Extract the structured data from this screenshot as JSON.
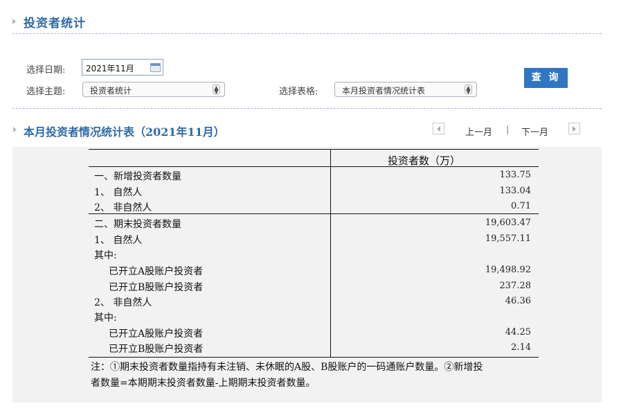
{
  "header": {
    "title": "投资者统计"
  },
  "form": {
    "date_label": "选择日期:",
    "date_value": "2021年11月",
    "topic_label": "选择主题:",
    "topic_value": "投资者统计",
    "table_label": "选择表格:",
    "table_value": "本月投资者情况统计表",
    "query_button": "查 询"
  },
  "section": {
    "title": "本月投资者情况统计表（2021年11月）",
    "prev_label": "上一月",
    "separator": "|",
    "next_label": "下一月"
  },
  "table": {
    "column_header": "投资者数（万）",
    "rows": [
      {
        "label": "一、新增投资者数量",
        "value": "133.75"
      },
      {
        "label": "1、 自然人",
        "value": "133.04"
      },
      {
        "label": "2、 非自然人",
        "value": "0.71"
      },
      {
        "label": "二、期末投资者数量",
        "value": "19,603.47"
      },
      {
        "label": "1、 自然人",
        "value": "19,557.11"
      },
      {
        "label": "其中:",
        "value": ""
      },
      {
        "label": "已开立A股账户投资者",
        "value": "19,498.92"
      },
      {
        "label": "已开立B股账户投资者",
        "value": "237.28"
      },
      {
        "label": "2、 非自然人",
        "value": "46.36"
      },
      {
        "label": "其中:",
        "value": ""
      },
      {
        "label": "已开立A股账户投资者",
        "value": "44.25"
      },
      {
        "label": "已开立B股账户投资者",
        "value": "2.14"
      }
    ],
    "note_line1": "注：①期末投资者数量指持有未注销、未休眠的A股、B股账户的一码通账户数量。②新增投",
    "note_line2": "者数量=本期期末投资者数量-上期期末投资者数量。"
  }
}
